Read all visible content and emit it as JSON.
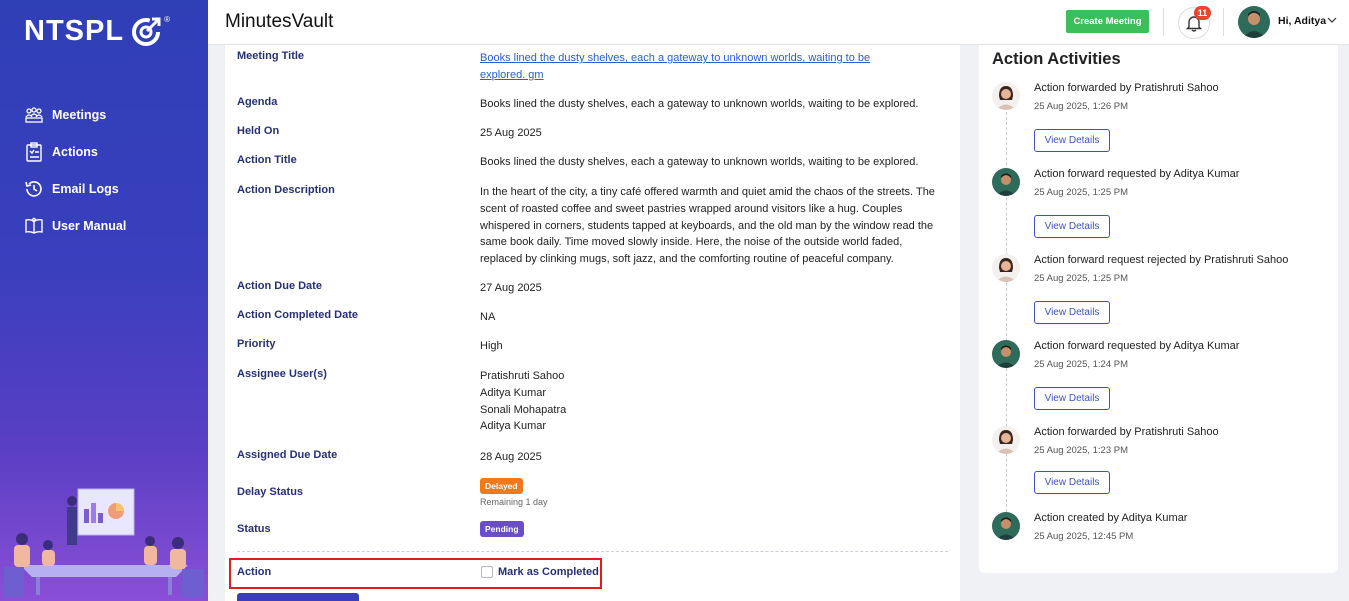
{
  "sidebar": {
    "logo_text": "NTSPL",
    "logo_reg": "®",
    "items": [
      {
        "label": "Meetings",
        "icon": "meetings-icon"
      },
      {
        "label": "Actions",
        "icon": "clipboard-icon"
      },
      {
        "label": "Email Logs",
        "icon": "history-icon"
      },
      {
        "label": "User Manual",
        "icon": "book-icon"
      }
    ]
  },
  "header": {
    "title": "MinutesVault",
    "create_meeting": "Create Meeting",
    "notification_count": "11",
    "greeting": "Hi, Aditya"
  },
  "details": {
    "meeting_title_label": "Meeting Title",
    "meeting_title_value": "Books lined the dusty shelves, each a gateway to unknown worlds, waiting to be explored. gm",
    "agenda_label": "Agenda",
    "agenda_value": "Books lined the dusty shelves, each a gateway to unknown worlds, waiting to be explored.",
    "held_on_label": "Held On",
    "held_on_value": "25 Aug 2025",
    "action_title_label": "Action Title",
    "action_title_value": "Books lined the dusty shelves, each a gateway to unknown worlds, waiting to be explored.",
    "action_description_label": "Action Description",
    "action_description_value": "In the heart of the city, a tiny café offered warmth and quiet amid the chaos of the streets. The scent of roasted coffee and sweet pastries wrapped around visitors like a hug. Couples whispered in corners, students tapped at keyboards, and the old man by the window read the same book daily. Time moved slowly inside. Here, the noise of the outside world faded, replaced by clinking mugs, soft jazz, and the comforting routine of peaceful company.",
    "action_due_date_label": "Action Due Date",
    "action_due_date_value": "27 Aug 2025",
    "action_completed_date_label": "Action Completed Date",
    "action_completed_date_value": "NA",
    "priority_label": "Priority",
    "priority_value": "High",
    "assignee_label": "Assignee User(s)",
    "assignees": [
      "Pratishruti Sahoo",
      "Aditya Kumar",
      "Sonali Mohapatra",
      "Aditya Kumar"
    ],
    "assigned_due_date_label": "Assigned Due Date",
    "assigned_due_date_value": "28 Aug 2025",
    "delay_status_label": "Delay Status",
    "delay_badge": "Delayed",
    "delay_note": "Remaining 1 day",
    "status_label": "Status",
    "status_badge": "Pending",
    "action_label": "Action",
    "mark_completed": "Mark as Completed",
    "colors": {
      "delayed": "#f07a1a",
      "pending": "#6a4fc4",
      "highlight": "#e11c1c"
    }
  },
  "activities": {
    "title": "Action Activities",
    "view_details": "View Details",
    "items": [
      {
        "text": "Action forwarded by Pratishruti Sahoo",
        "time": "25 Aug 2025, 1:26 PM",
        "avatar": "female-avatar",
        "has_button": true
      },
      {
        "text": "Action forward requested by Aditya Kumar",
        "time": "25 Aug 2025, 1:25 PM",
        "avatar": "male-avatar",
        "has_button": true
      },
      {
        "text": "Action forward request rejected by Pratishruti Sahoo",
        "time": "25 Aug 2025, 1:25 PM",
        "avatar": "female-avatar",
        "has_button": true
      },
      {
        "text": "Action forward requested by Aditya Kumar",
        "time": "25 Aug 2025, 1:24 PM",
        "avatar": "male-avatar",
        "has_button": true
      },
      {
        "text": "Action forwarded by Pratishruti Sahoo",
        "time": "25 Aug 2025, 1:23 PM",
        "avatar": "female-avatar",
        "has_button": true
      },
      {
        "text": "Action created by Aditya Kumar",
        "time": "25 Aug 2025, 12:45 PM",
        "avatar": "male-avatar",
        "has_button": false
      }
    ]
  }
}
